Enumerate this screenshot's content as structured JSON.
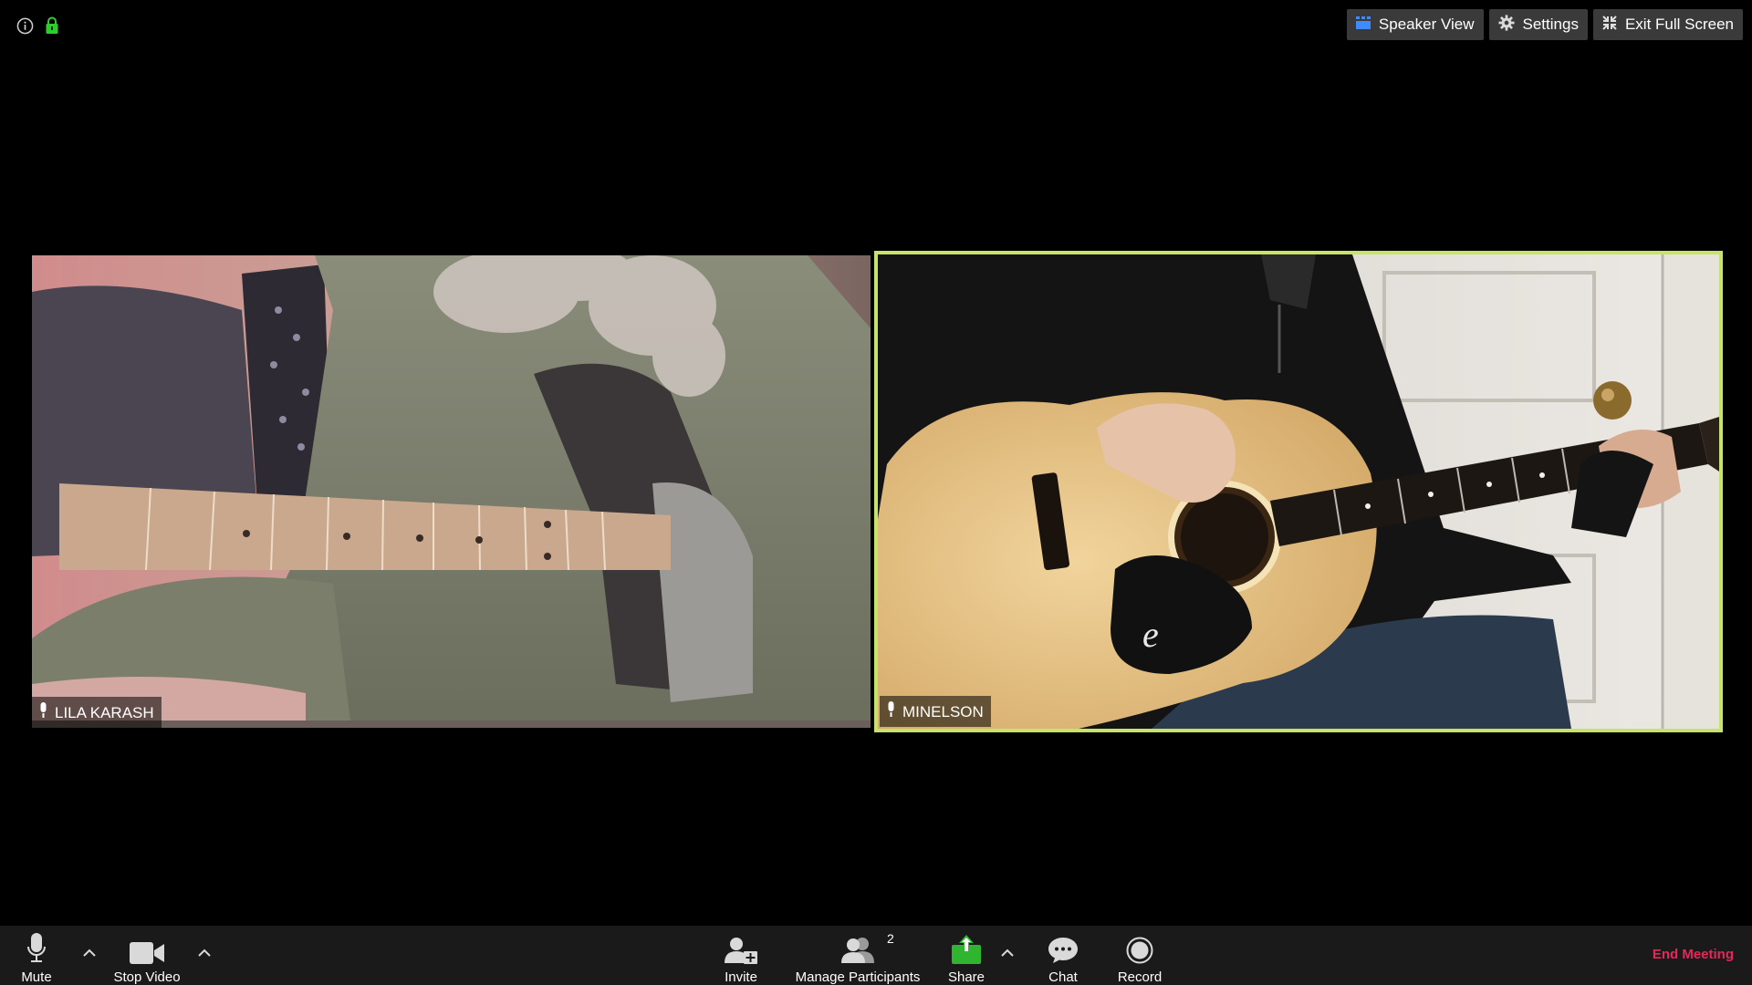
{
  "top_right": {
    "speaker_view": "Speaker View",
    "settings": "Settings",
    "exit_full_screen": "Exit Full Screen"
  },
  "participants": [
    {
      "name": "LILA KARASH"
    },
    {
      "name": "MINELSON"
    }
  ],
  "toolbar": {
    "mute": "Mute",
    "stop_video": "Stop Video",
    "invite": "Invite",
    "manage_participants": "Manage Participants",
    "participant_count": "2",
    "share": "Share",
    "chat": "Chat",
    "record": "Record",
    "end_meeting": "End Meeting"
  },
  "colors": {
    "active_speaker_border": "#c8e36a",
    "share_green": "#2fb52f",
    "end_meeting_red": "#e8265b",
    "lock_green": "#2fcc2f",
    "speaker_view_blue": "#3d8bff"
  },
  "icons": [
    "info-icon",
    "lock-icon",
    "speaker-view-icon",
    "gear-icon",
    "exit-full-screen-icon",
    "microphone-icon",
    "video-camera-icon",
    "invite-icon",
    "participants-icon",
    "share-icon",
    "chat-icon",
    "record-icon",
    "chevron-up-icon"
  ]
}
